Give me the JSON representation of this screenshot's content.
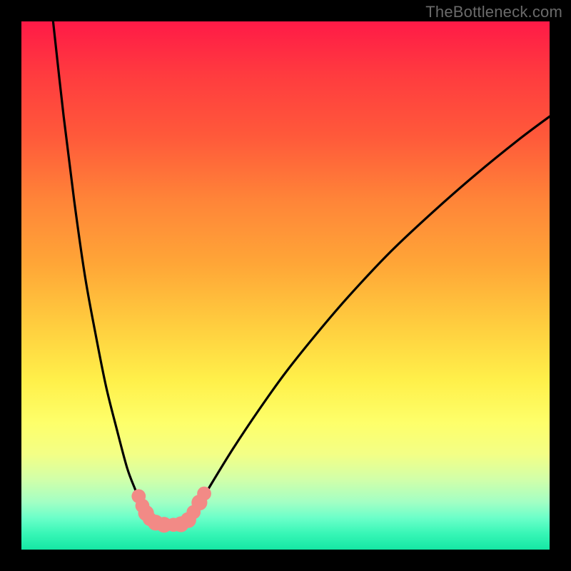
{
  "watermark": "TheBottleneck.com",
  "colors": {
    "frame": "#000000",
    "curve": "#000000",
    "marker_fill": "#f28a86",
    "marker_stroke": "#c96a66"
  },
  "chart_data": {
    "type": "line",
    "title": "",
    "xlabel": "",
    "ylabel": "",
    "xlim": [
      0,
      100
    ],
    "ylim": [
      0,
      100
    ],
    "grid": false,
    "annotations": [],
    "series": [
      {
        "name": "left-branch",
        "x": [
          6,
          8,
          10,
          12,
          14,
          16,
          18,
          20,
          21.5,
          22.5,
          23.3,
          24,
          24.5,
          25
        ],
        "y": [
          100,
          82,
          66,
          52,
          41,
          31,
          23,
          15.5,
          11.5,
          9,
          7.3,
          6.2,
          5.5,
          5.2
        ]
      },
      {
        "name": "valley-floor",
        "x": [
          25,
          27,
          29,
          31
        ],
        "y": [
          5.2,
          4.7,
          4.7,
          5.0
        ]
      },
      {
        "name": "right-branch",
        "x": [
          31,
          33,
          36,
          40,
          45,
          50,
          56,
          62,
          70,
          78,
          86,
          94,
          100
        ],
        "y": [
          5.0,
          7.5,
          12.5,
          19,
          26.5,
          33.5,
          41,
          48,
          56.5,
          64,
          71,
          77.5,
          82
        ]
      }
    ],
    "markers": [
      {
        "x": 22.2,
        "y": 10.1,
        "r": 1.2
      },
      {
        "x": 22.9,
        "y": 8.3,
        "r": 1.2
      },
      {
        "x": 23.6,
        "y": 6.9,
        "r": 1.5
      },
      {
        "x": 24.3,
        "y": 5.8,
        "r": 1.2
      },
      {
        "x": 25.4,
        "y": 5.1,
        "r": 1.5
      },
      {
        "x": 27.0,
        "y": 4.7,
        "r": 1.5
      },
      {
        "x": 28.8,
        "y": 4.7,
        "r": 1.2
      },
      {
        "x": 30.2,
        "y": 4.8,
        "r": 1.5
      },
      {
        "x": 31.6,
        "y": 5.6,
        "r": 1.5
      },
      {
        "x": 32.6,
        "y": 7.1,
        "r": 1.2
      },
      {
        "x": 33.7,
        "y": 8.9,
        "r": 1.5
      },
      {
        "x": 34.6,
        "y": 10.6,
        "r": 1.2
      }
    ]
  }
}
